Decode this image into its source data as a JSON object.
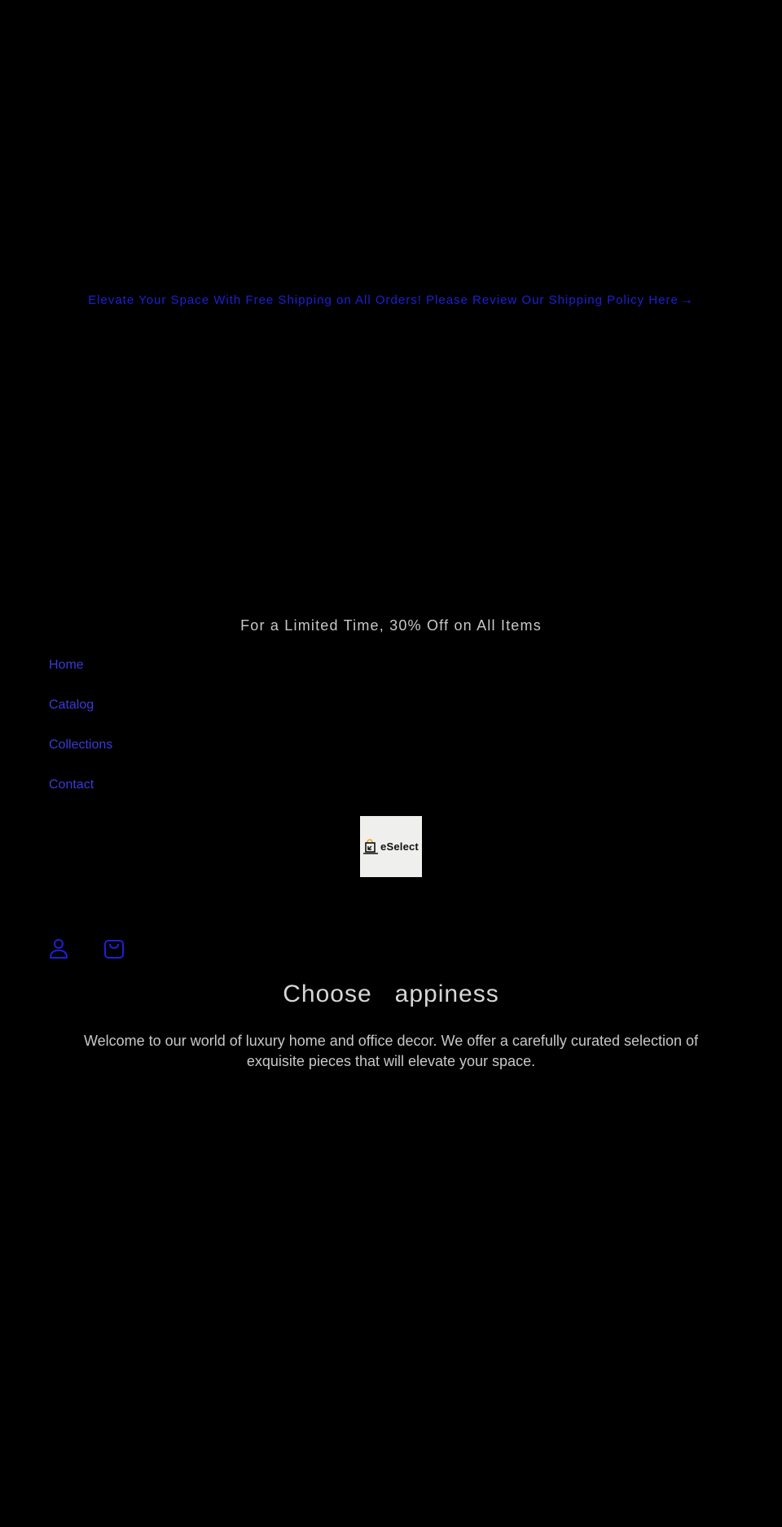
{
  "announcement": {
    "text": "Elevate Your Space With Free Shipping on All Orders! Please Review Our Shipping Policy Here",
    "arrow_icon": "arrow-right-icon"
  },
  "promo": {
    "text": "For a Limited Time, 30% Off on All Items"
  },
  "nav": {
    "items": [
      {
        "label": "Home"
      },
      {
        "label": "Catalog"
      },
      {
        "label": "Collections"
      },
      {
        "label": "Contact"
      }
    ]
  },
  "logo": {
    "text": "eSelect",
    "accent_color": "#f5a623"
  },
  "header_icons": {
    "account_icon": "account-icon",
    "cart_icon": "cart-icon"
  },
  "hero": {
    "title": "Choose   appiness",
    "description": "Welcome to our world of luxury home and office decor. We offer a carefully curated selection of exquisite pieces that will elevate your space."
  },
  "colors": {
    "background": "#000000",
    "link": "#1f1fd6",
    "text": "#c8c8c8"
  }
}
